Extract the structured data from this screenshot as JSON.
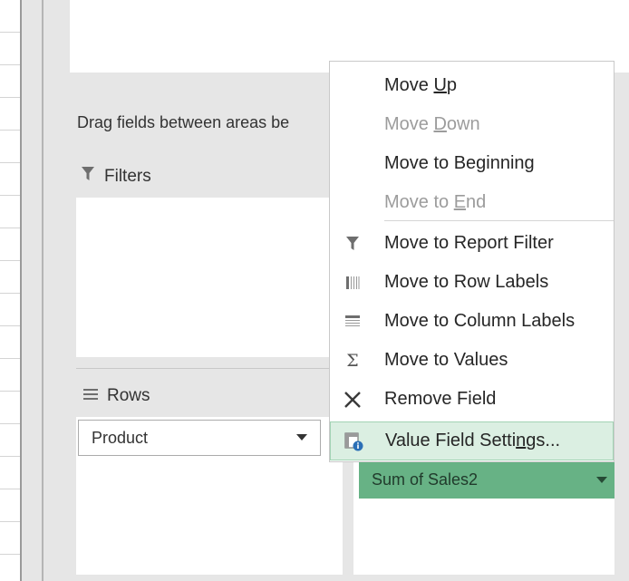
{
  "hint_text": "Drag fields between areas be",
  "areas": {
    "filters": {
      "title": "Filters"
    },
    "rows": {
      "title": "Rows"
    }
  },
  "rows_field": {
    "label": "Product"
  },
  "values_field": {
    "label": "Sum of Sales2"
  },
  "menu": {
    "items": [
      {
        "pre": "Move ",
        "key": "U",
        "post": "p",
        "disabled": false
      },
      {
        "pre": "Move ",
        "key": "D",
        "post": "own",
        "disabled": true
      },
      {
        "pre": "Move to Be",
        "key": "g",
        "post": "inning",
        "disabled": false
      },
      {
        "pre": "Move to ",
        "key": "E",
        "post": "nd",
        "disabled": true
      },
      {
        "label": "Move to Report Filter",
        "icon": "filter-icon"
      },
      {
        "label": "Move to Row Labels",
        "icon": "row-labels-icon"
      },
      {
        "label": "Move to Column Labels",
        "icon": "column-labels-icon"
      },
      {
        "label": "Move to Values",
        "icon": "sigma-icon"
      },
      {
        "label": "Remove Field",
        "icon": "close-icon"
      },
      {
        "pre": "Value Field Setti",
        "key": "n",
        "post": "gs...",
        "icon": "field-settings-icon",
        "highlighted": true
      }
    ]
  },
  "colors": {
    "highlight": "#dbefe2",
    "values_chip": "#67b285",
    "disabled_text": "#9c9c9c"
  }
}
